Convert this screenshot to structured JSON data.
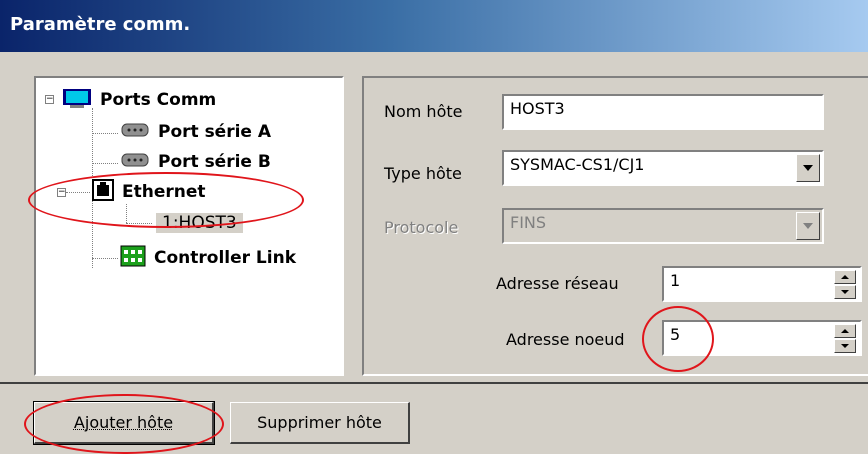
{
  "window": {
    "title": "Paramètre comm."
  },
  "tree": {
    "root": {
      "label": "Ports Comm"
    },
    "items": [
      {
        "label": "Port série A",
        "icon": "serial-port-icon"
      },
      {
        "label": "Port série B",
        "icon": "serial-port-icon"
      },
      {
        "label": "Ethernet",
        "icon": "ethernet-port-icon"
      },
      {
        "label": "1:HOST3",
        "icon": "none"
      },
      {
        "label": "Controller Link",
        "icon": "controller-link-icon"
      }
    ]
  },
  "form": {
    "host_name": {
      "label": "Nom hôte",
      "value": "HOST3"
    },
    "host_type": {
      "label": "Type hôte",
      "value": "SYSMAC-CS1/CJ1"
    },
    "protocol": {
      "label": "Protocole",
      "value": "FINS"
    },
    "network_address": {
      "label": "Adresse réseau",
      "value": "1"
    },
    "node_address": {
      "label": "Adresse noeud",
      "value": "5"
    }
  },
  "buttons": {
    "add_host": "Ajouter hôte",
    "remove_host": "Supprimer hôte"
  },
  "colors": {
    "annotation": "#e0151b",
    "titlebar_start": "#0a246a",
    "titlebar_end": "#a6caf0",
    "icon_cyan": "#00c8e8",
    "icon_green": "#1ca01c"
  }
}
